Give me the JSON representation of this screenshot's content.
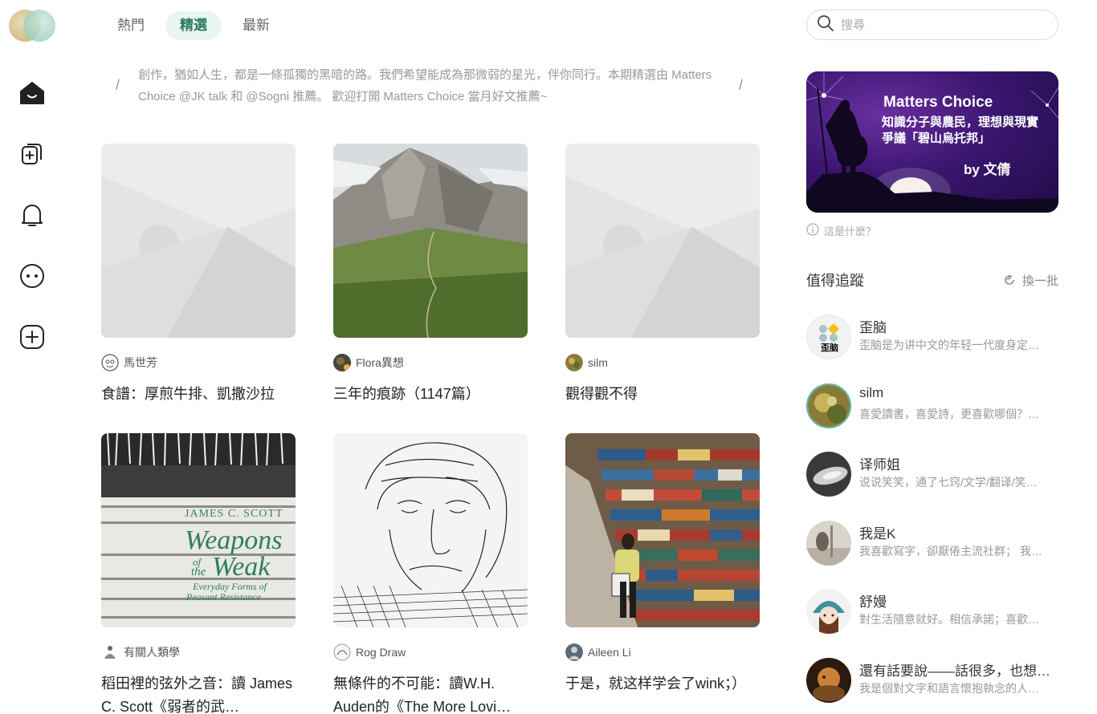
{
  "nav": {
    "icons": [
      "home-icon",
      "write-icon",
      "bell-icon",
      "more-icon",
      "add-icon"
    ]
  },
  "tabs": [
    {
      "label": "熱門"
    },
    {
      "label": "精選"
    },
    {
      "label": "最新"
    }
  ],
  "announcement": {
    "text": "創作，猶如人生，都是一條孤獨的黑暗的路。我們希望能成為那微弱的星光，伴你同行。本期精選由 Matters Choice @JK talk 和 @Sogni 推薦。 歡迎打開 Matters Choice 當月好文推薦~",
    "left_mark": "/",
    "right_mark": "/"
  },
  "articles": [
    {
      "author": "馬世芳",
      "title": "食譜：厚煎牛排、凱撒沙拉",
      "image": "placeholder"
    },
    {
      "author": "Flora異想",
      "title": "三年的痕跡（1147篇）",
      "image": "mountain"
    },
    {
      "author": "silm",
      "title": "觀得觀不得",
      "image": "placeholder"
    },
    {
      "author": "有關人類學",
      "title": "稻田裡的弦外之音：讀 James C. Scott《弱者的武…",
      "image": "book"
    },
    {
      "author": "Rog Draw",
      "title": "無條件的不可能：讀W.H. Auden的《The More Lovi…",
      "image": "sketch"
    },
    {
      "author": "Aileen Li",
      "title": "于是，就这样学会了wink；）",
      "image": "library"
    }
  ],
  "book_cover": {
    "author": "JAMES C. SCOTT",
    "line1": "Weapons",
    "line2": "of",
    "line3": "the",
    "line4": "Weak",
    "sub1": "Everyday Forms of",
    "sub2": "Peasant Resistance"
  },
  "search": {
    "placeholder": "搜尋"
  },
  "banner": {
    "title": "Matters Choice",
    "line1": "知識分子與農民，理想與現實",
    "line2": "爭議「碧山烏托邦」",
    "byline": "by 文倩"
  },
  "whatis": {
    "label": "這是什麼？"
  },
  "follow": {
    "heading": "值得追蹤",
    "shuffle": "換一批",
    "users": [
      {
        "name": "歪脑",
        "desc": "歪脑是为讲中文的年轻一代度身定…"
      },
      {
        "name": "silm",
        "desc": "喜愛讀書，喜愛詩，更喜歡哪個？…"
      },
      {
        "name": "译师姐",
        "desc": "说说笑笑，通了七窍/文学/翻译/笑…"
      },
      {
        "name": "我是K",
        "desc": "我喜歡寫字，卻厭倦主流社群； 我…"
      },
      {
        "name": "舒嫚",
        "desc": "對生活隨意就好。相信承諾；喜歡…"
      },
      {
        "name": "還有話要說——話很多，也想…",
        "desc": "我是個對文字和語言懷抱執念的人…"
      }
    ]
  },
  "colors": {
    "accent": "#2a7a64",
    "tab_active_bg": "#e9f5f1"
  }
}
